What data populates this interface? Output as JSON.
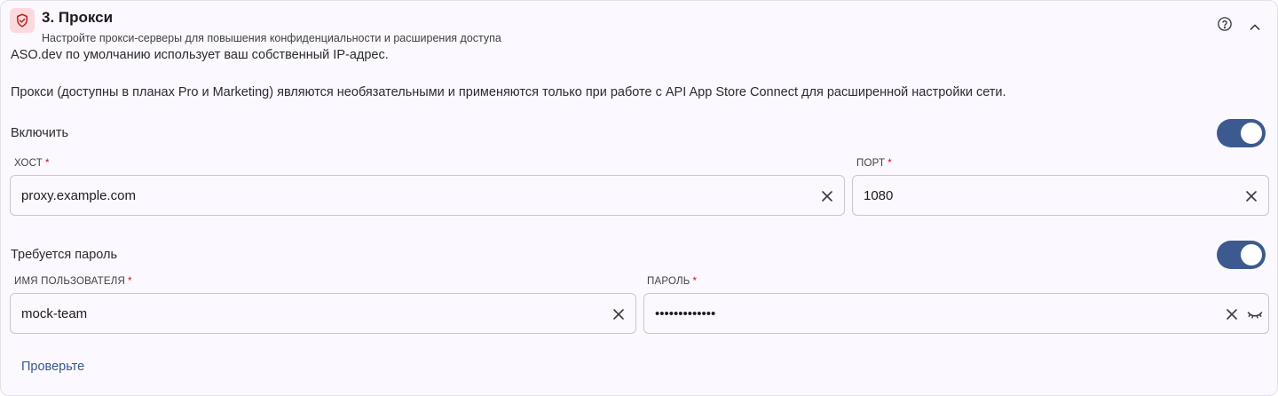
{
  "section": {
    "title": "3. Прокси",
    "subtitle": "Настройте прокси-серверы для повышения конфиденциальности и расширения доступа",
    "icon": "shield-icon",
    "accent_color": "#b3261e"
  },
  "description": {
    "line1": "ASO.dev по умолчанию использует ваш собственный IP-адрес.",
    "line2": "Прокси (доступны в планах Pro и Marketing) являются необязательными и применяются только при работе с API App Store Connect для расширенной настройки сети."
  },
  "enable": {
    "label": "Включить",
    "checked": true
  },
  "host": {
    "label": "ХОСТ",
    "required_mark": "*",
    "value": "proxy.example.com"
  },
  "port": {
    "label": "ПОРТ",
    "required_mark": "*",
    "value": "1080"
  },
  "password_required": {
    "label": "Требуется пароль",
    "checked": true
  },
  "username": {
    "label": "ИМЯ ПОЛЬЗОВАТЕЛЯ",
    "required_mark": "*",
    "value": "mock-team"
  },
  "password": {
    "label": "ПАРОЛЬ",
    "required_mark": "*",
    "value": "•••••••••••••"
  },
  "actions": {
    "verify_label": "Проверьте"
  },
  "colors": {
    "toggle_on": "#3c5a8f",
    "required": "#c4161c",
    "link": "#35578f"
  }
}
